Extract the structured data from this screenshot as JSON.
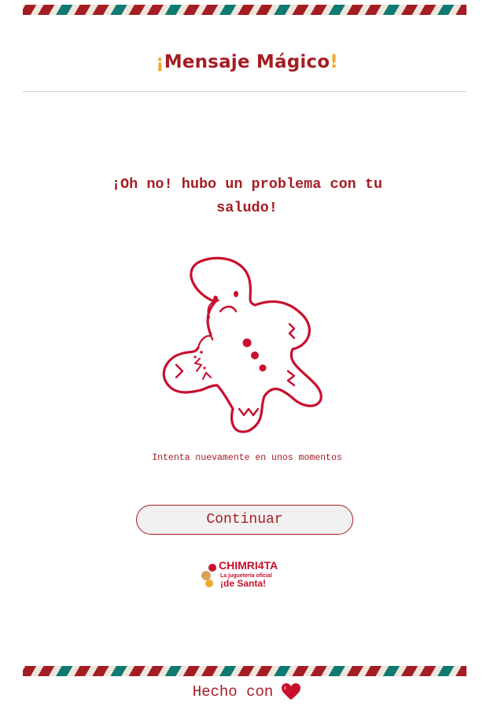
{
  "header": {
    "title_open": "¡",
    "title_text": "Mensaje Mágico",
    "title_close": "!"
  },
  "message": {
    "title": "¡Oh no! hubo un problema con tu saludo!",
    "note": "Intenta nuevamente en unos momentos"
  },
  "actions": {
    "continue_label": "Continuar"
  },
  "brand": {
    "logo_icon": "chimuelo-logo",
    "logo_text_top": "CHIMRI4TA",
    "logo_text_middle": "La juguetería oficial",
    "logo_text_bottom": "¡de Santa!"
  },
  "footer": {
    "text": "Hecho con",
    "heart_icon": "heart-icon"
  },
  "colors": {
    "primary": "#a51d24",
    "accent": "#f0a830",
    "teal": "#0f7a72"
  }
}
